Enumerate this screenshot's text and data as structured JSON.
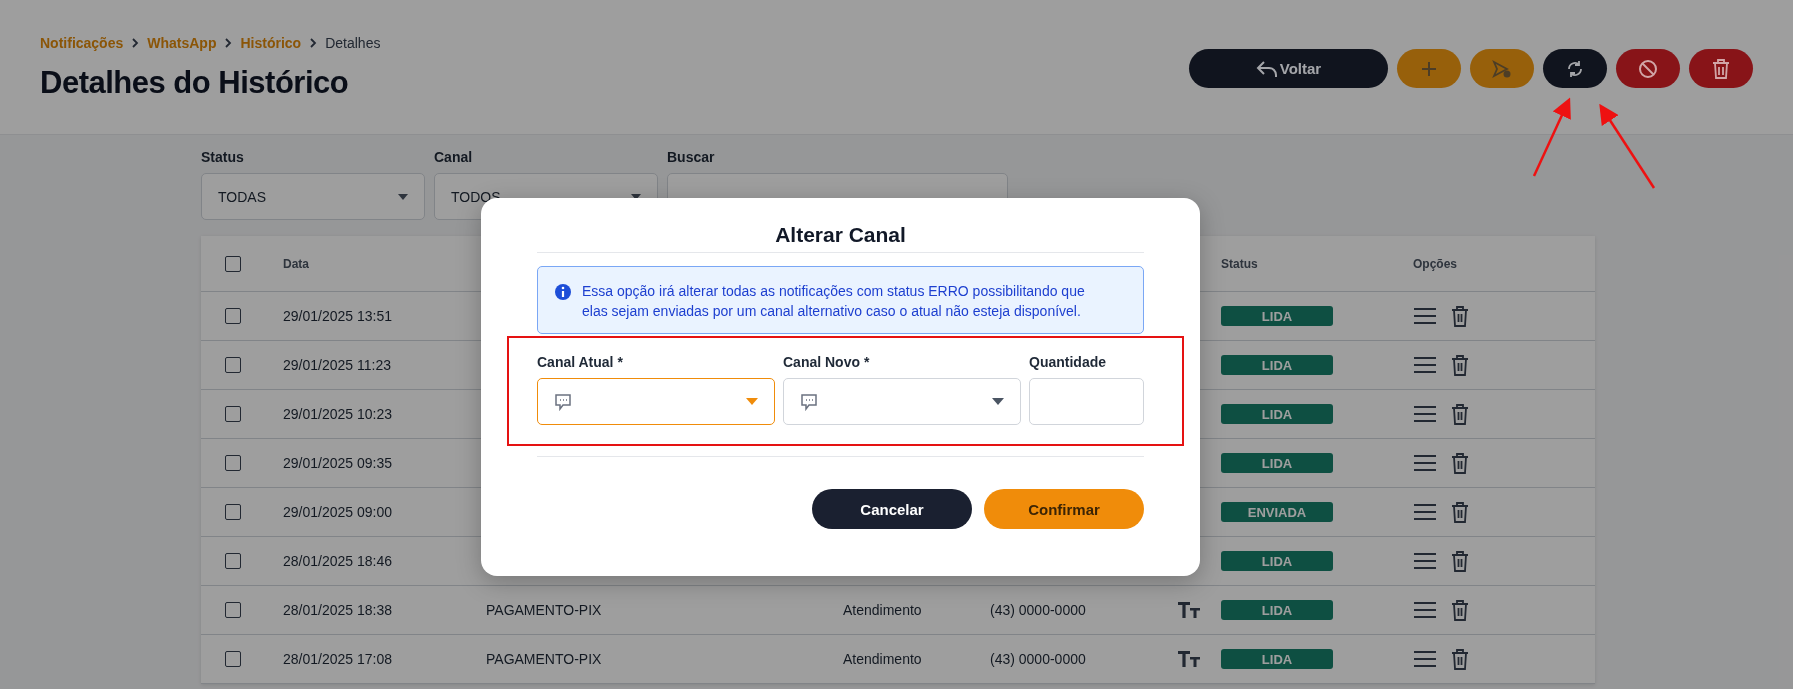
{
  "breadcrumb": [
    {
      "label": "Notificações",
      "link": true
    },
    {
      "label": "WhatsApp",
      "link": true
    },
    {
      "label": "Histórico",
      "link": true
    },
    {
      "label": "Detalhes",
      "link": false
    }
  ],
  "title": "Detalhes do Histórico",
  "actions": [
    {
      "kind": "back",
      "label": "Voltar",
      "color": "#10141e"
    },
    {
      "kind": "add",
      "color": "#97600b"
    },
    {
      "kind": "send",
      "color": "#97600b"
    },
    {
      "kind": "refresh",
      "color": "#10141e"
    },
    {
      "kind": "block",
      "color": "#881418"
    },
    {
      "kind": "delete",
      "color": "#881418"
    }
  ],
  "filters": [
    {
      "kind": "select",
      "label": "Status",
      "value": "TODAS"
    },
    {
      "kind": "select",
      "label": "Canal",
      "value": "TODOS"
    },
    {
      "kind": "text",
      "label": "Buscar"
    }
  ],
  "table": {
    "all_checked": false,
    "columns": [
      "Data",
      "Status",
      "Opções"
    ],
    "rows": [
      {
        "checked": false,
        "date": "29/01/2025 13:51",
        "status": "LIDA"
      },
      {
        "checked": false,
        "date": "29/01/2025 11:23",
        "status": "LIDA"
      },
      {
        "checked": false,
        "date": "29/01/2025 10:23",
        "status": "LIDA"
      },
      {
        "checked": false,
        "date": "29/01/2025 09:35",
        "status": "LIDA"
      },
      {
        "checked": false,
        "date": "29/01/2025 09:00",
        "status": "ENVIADA"
      },
      {
        "checked": false,
        "date": "28/01/2025 18:46",
        "status": "LIDA"
      },
      {
        "checked": false,
        "date": "28/01/2025 18:38",
        "template": "PAGAMENTO-PIX",
        "channel": "Atendimento",
        "phone": "(43) 0000-0000",
        "status": "LIDA"
      },
      {
        "checked": false,
        "date": "28/01/2025 17:08",
        "template": "PAGAMENTO-PIX",
        "channel": "Atendimento",
        "phone": "(43) 0000-0000",
        "status": "LIDA"
      }
    ]
  },
  "modal": {
    "title": "Alterar Canal",
    "info": "Essa opção irá alterar todas as notificações com status ERRO possibilitando que elas sejam enviadas por um canal alternativo caso o atual não esteja disponível.",
    "fields": [
      {
        "kind": "select",
        "label": "Canal Atual *",
        "focused": true
      },
      {
        "kind": "select",
        "label": "Canal Novo *",
        "focused": false
      },
      {
        "kind": "number",
        "label": "Quantidade",
        "focused": false
      }
    ],
    "buttons": [
      {
        "kind": "cancel",
        "label": "Cancelar"
      },
      {
        "kind": "confirm",
        "label": "Confirmar"
      }
    ]
  }
}
